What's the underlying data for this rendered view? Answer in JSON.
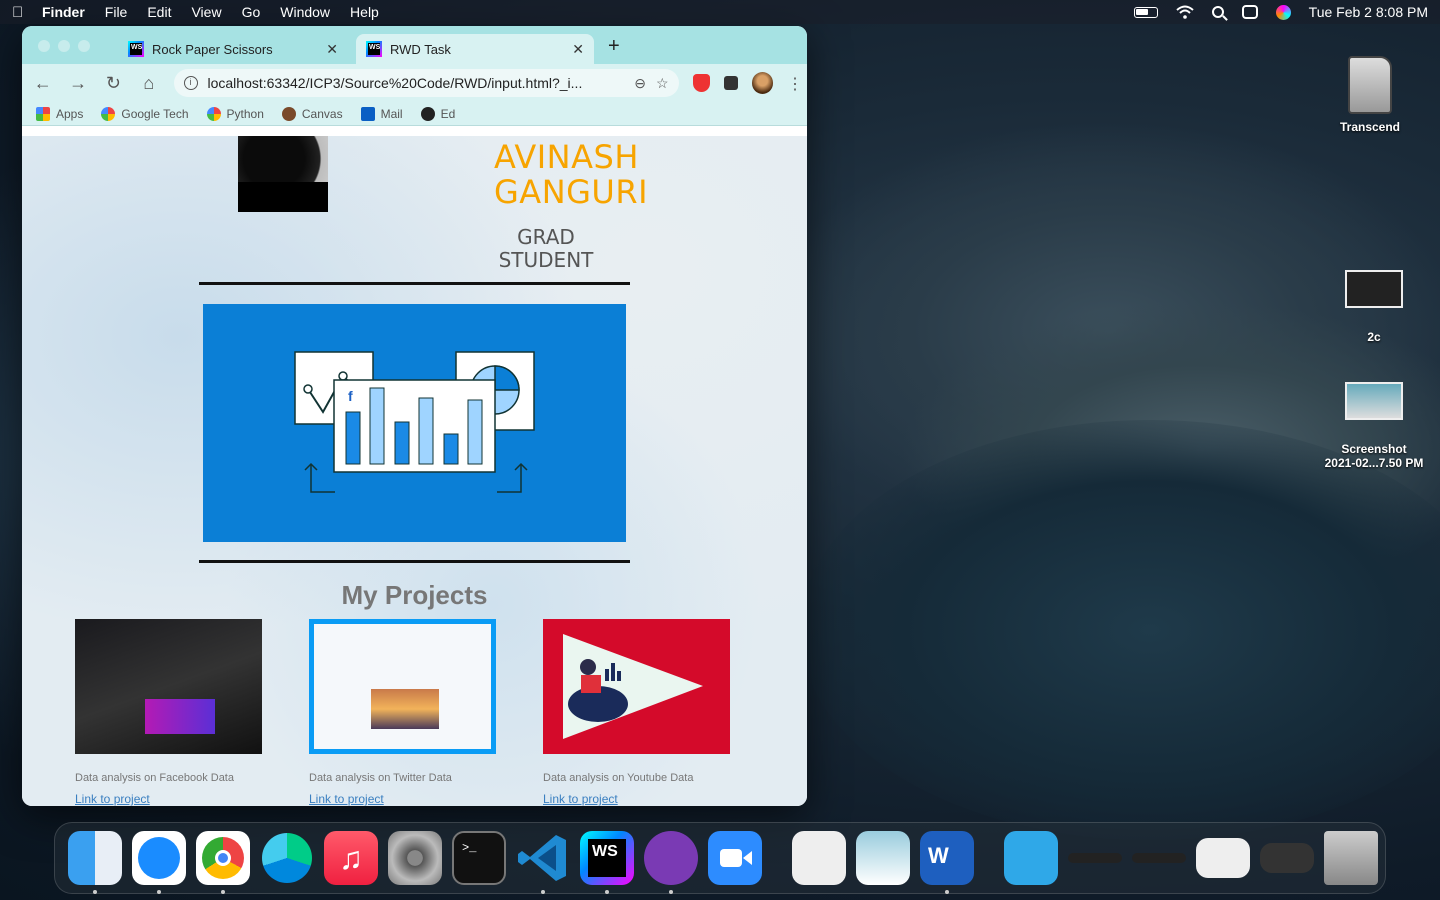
{
  "menubar": {
    "app": "Finder",
    "items": [
      "File",
      "Edit",
      "View",
      "Go",
      "Window",
      "Help"
    ],
    "datetime": "Tue Feb 2  8:08 PM"
  },
  "browser": {
    "tabs": [
      {
        "title": "Rock Paper Scissors",
        "active": false
      },
      {
        "title": "RWD Task",
        "active": true
      }
    ],
    "url": "localhost:63342/ICP3/Source%20Code/RWD/input.html?_i...",
    "bookmarks": [
      "Apps",
      "Google Tech",
      "Python",
      "Canvas",
      "Mail",
      "Ed"
    ]
  },
  "page": {
    "name_line1": "AVINASH",
    "name_line2": "GANGURI",
    "role_line1": "GRAD",
    "role_line2": "STUDENT",
    "projects_title": "My Projects",
    "projects": [
      {
        "caption": "Data analysis on Facebook Data",
        "link": "Link to project"
      },
      {
        "caption": "Data analysis on Twitter Data",
        "link": "Link to project"
      },
      {
        "caption": "Data analysis on Youtube Data",
        "link": "Link to project"
      }
    ]
  },
  "desktop": {
    "icons": [
      "Transcend",
      "2c",
      "Screenshot",
      "2021-02...7.50 PM"
    ]
  },
  "dock": {
    "apps": [
      "Finder",
      "Safari",
      "Chrome",
      "Edge",
      "Music",
      "System Preferences",
      "Terminal",
      "VS Code",
      "WebStorm",
      "GitHub Desktop",
      "Zoom",
      "System Information",
      "Preview",
      "Word",
      "Downloads",
      "Trash"
    ]
  },
  "colors": {
    "tab_bar": "#a6e2e3",
    "name_accent": "#f7a400",
    "hero_blue": "#0b7fd6",
    "youtube_red": "#d40a2a"
  }
}
